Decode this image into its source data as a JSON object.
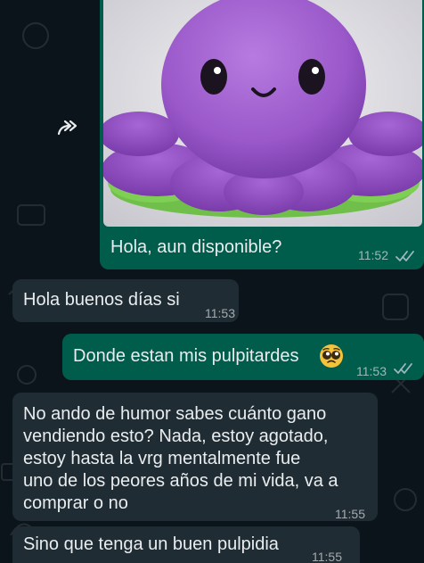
{
  "messages": [
    {
      "id": "m1",
      "direction": "outgoing",
      "has_image": true,
      "image_subject": "purple-octopus-plush",
      "text": "Hola, aun disponible?",
      "time": "11:52",
      "status": "read"
    },
    {
      "id": "m2",
      "direction": "incoming",
      "text": "Hola buenos días si",
      "time": "11:53"
    },
    {
      "id": "m3",
      "direction": "outgoing",
      "text": "Donde estan mis pulpitardes",
      "emoji": "pleading-face-emoji",
      "time": "11:53",
      "status": "read"
    },
    {
      "id": "m4",
      "direction": "incoming",
      "lines": [
        "No ando de humor sabes cuánto gano",
        "vendiendo esto? Nada, estoy agotado,",
        "estoy hasta la vrg mentalmente fue",
        "uno de los peores años de mi vida, va a",
        "comprar o no"
      ],
      "time": "11:55"
    },
    {
      "id": "m5",
      "direction": "incoming",
      "text": "Sino que tenga un buen pulpidia",
      "time": "11:55"
    }
  ],
  "icons": {
    "forward": "forward-icon",
    "read_receipt": "double-check-icon"
  },
  "colors": {
    "background": "#0b141a",
    "incoming_bubble": "#202c33",
    "outgoing_bubble": "#005c4b",
    "text": "#e9edef",
    "read_ticks": "#9fb6c0"
  }
}
